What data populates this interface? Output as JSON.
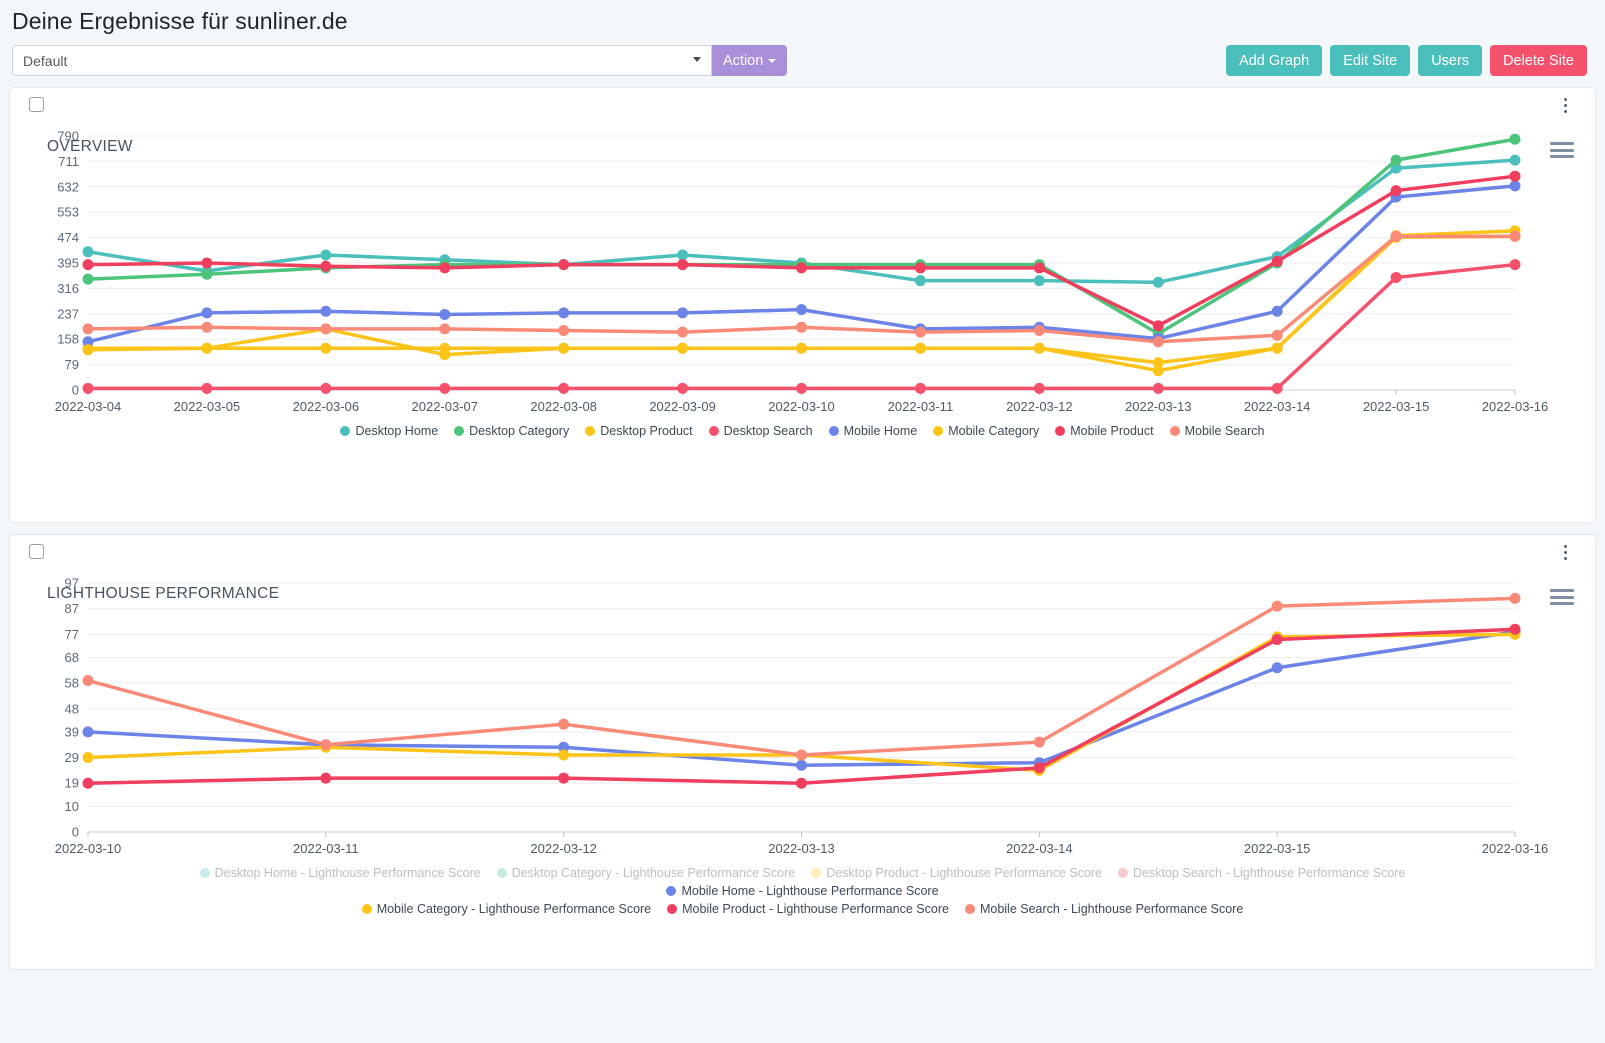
{
  "header": {
    "title": "Deine Ergebnisse für sunliner.de",
    "select": {
      "value": "Default",
      "options": [
        "Default"
      ]
    },
    "action_label": "Action",
    "buttons": [
      {
        "label": "Add Graph",
        "style": "teal",
        "name": "add-graph-button"
      },
      {
        "label": "Edit Site",
        "style": "teal",
        "name": "edit-site-button"
      },
      {
        "label": "Users",
        "style": "teal",
        "name": "users-button"
      },
      {
        "label": "Delete Site",
        "style": "red",
        "name": "delete-site-button"
      }
    ]
  },
  "colors": {
    "teal": "#4bbfbb",
    "green": "#4cc47c",
    "yellow": "#fcc419",
    "red": "#f4516c",
    "blue": "#6c83e8",
    "salmon": "#fa8a78",
    "purple": "#a98eda",
    "crimson": "#f03e5e"
  },
  "cards": [
    {
      "title": "OVERVIEW",
      "chart_index": 0
    },
    {
      "title": "LIGHTHOUSE PERFORMANCE",
      "chart_index": 1
    }
  ],
  "chart_data": [
    {
      "type": "line",
      "title": "OVERVIEW",
      "xlabel": "",
      "ylabel": "",
      "grid": true,
      "legend_position": "bottom",
      "ylim": [
        0,
        790
      ],
      "yticks": [
        0,
        79,
        158,
        237,
        316,
        395,
        474,
        553,
        632,
        711,
        790
      ],
      "x": [
        "2022-03-04",
        "2022-03-05",
        "2022-03-06",
        "2022-03-07",
        "2022-03-08",
        "2022-03-09",
        "2022-03-10",
        "2022-03-11",
        "2022-03-12",
        "2022-03-13",
        "2022-03-14",
        "2022-03-15",
        "2022-03-16"
      ],
      "series": [
        {
          "name": "Desktop Home",
          "color": "#4bbfbb",
          "active": true,
          "values": [
            430,
            370,
            420,
            405,
            390,
            420,
            395,
            340,
            340,
            335,
            415,
            690,
            715
          ]
        },
        {
          "name": "Desktop Category",
          "color": "#4cc47c",
          "active": true,
          "values": [
            345,
            360,
            380,
            390,
            390,
            390,
            390,
            390,
            390,
            175,
            395,
            715,
            780
          ]
        },
        {
          "name": "Desktop Product",
          "color": "#fcc419",
          "active": true,
          "values": [
            130,
            130,
            190,
            110,
            130,
            130,
            130,
            130,
            130,
            60,
            130,
            480,
            495
          ]
        },
        {
          "name": "Desktop Search",
          "color": "#f4516c",
          "active": true,
          "values": [
            5,
            5,
            5,
            5,
            5,
            5,
            5,
            5,
            5,
            5,
            5,
            350,
            390
          ]
        },
        {
          "name": "Mobile Home",
          "color": "#6c83e8",
          "active": true,
          "values": [
            150,
            240,
            245,
            235,
            240,
            240,
            250,
            190,
            195,
            160,
            245,
            600,
            635
          ]
        },
        {
          "name": "Mobile Category",
          "color": "#fcc419",
          "active": true,
          "values": [
            125,
            130,
            130,
            130,
            130,
            130,
            130,
            130,
            130,
            85,
            130,
            475,
            478
          ]
        },
        {
          "name": "Mobile Product",
          "color": "#f03e5e",
          "active": true,
          "values": [
            390,
            395,
            385,
            380,
            390,
            390,
            380,
            380,
            380,
            200,
            400,
            620,
            665
          ]
        },
        {
          "name": "Mobile Search",
          "color": "#fa8a78",
          "active": true,
          "values": [
            190,
            195,
            190,
            190,
            185,
            180,
            195,
            180,
            185,
            150,
            170,
            478,
            478
          ]
        }
      ]
    },
    {
      "type": "line",
      "title": "LIGHTHOUSE PERFORMANCE",
      "xlabel": "",
      "ylabel": "",
      "grid": true,
      "legend_position": "bottom",
      "ylim": [
        0,
        97
      ],
      "yticks": [
        0,
        10,
        19,
        29,
        39,
        48,
        58,
        68,
        77,
        87,
        97
      ],
      "x": [
        "2022-03-10",
        "2022-03-11",
        "2022-03-12",
        "2022-03-13",
        "2022-03-14",
        "2022-03-15",
        "2022-03-16"
      ],
      "series": [
        {
          "name": "Desktop Home - Lighthouse Performance Score",
          "color": "#4bbfbb",
          "active": false,
          "values": []
        },
        {
          "name": "Desktop Category - Lighthouse Performance Score",
          "color": "#4cc47c",
          "active": false,
          "values": []
        },
        {
          "name": "Desktop Product - Lighthouse Performance Score",
          "color": "#fcc419",
          "active": false,
          "values": []
        },
        {
          "name": "Desktop Search - Lighthouse Performance Score",
          "color": "#f4516c",
          "active": false,
          "values": []
        },
        {
          "name": "Mobile Home - Lighthouse Performance Score",
          "color": "#6c83e8",
          "active": true,
          "values": [
            39,
            34,
            33,
            26,
            27,
            64,
            78
          ]
        },
        {
          "name": "Mobile Category - Lighthouse Performance Score",
          "color": "#fcc419",
          "active": true,
          "values": [
            29,
            33,
            30,
            30,
            24,
            76,
            77
          ]
        },
        {
          "name": "Mobile Product - Lighthouse Performance Score",
          "color": "#f03e5e",
          "active": true,
          "values": [
            19,
            21,
            21,
            19,
            25,
            75,
            79
          ]
        },
        {
          "name": "Mobile Search - Lighthouse Performance Score",
          "color": "#fa8a78",
          "active": true,
          "values": [
            59,
            34,
            42,
            30,
            35,
            88,
            91
          ]
        }
      ]
    }
  ]
}
